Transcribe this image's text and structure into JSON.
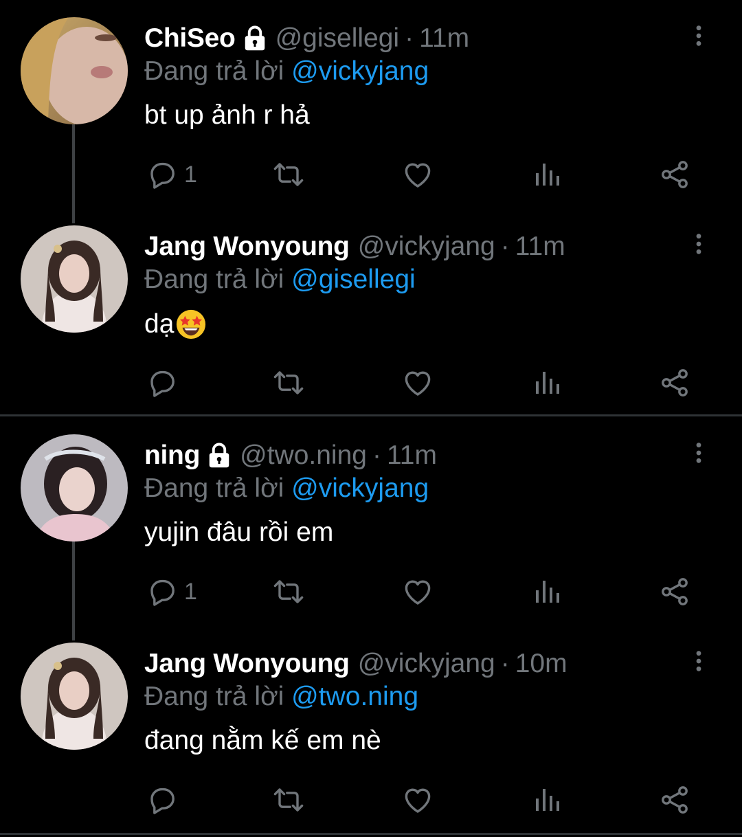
{
  "colors": {
    "background": "#000000",
    "name_text": "#ffffff",
    "muted_text": "#71767b",
    "mention_link": "#1d9bf0",
    "icon": "#71767b",
    "divider": "#2f3336"
  },
  "icons": {
    "lock": "lock-icon",
    "more": "more-vertical-icon",
    "reply": "reply-icon",
    "retweet": "retweet-icon",
    "like": "heart-icon",
    "views": "views-icon",
    "share": "share-icon"
  },
  "tweets": [
    {
      "name": "ChiSeo",
      "handle": "@gisellegi",
      "separator": "·",
      "time": "11m",
      "reply_prefix": "Đang trả lời",
      "reply_to": "@vickyjang",
      "text": "bt up ảnh r hả",
      "reply_count": "1"
    },
    {
      "name": "Jang Wonyoung",
      "handle": "@vickyjang",
      "separator": "·",
      "time": "11m",
      "reply_prefix": "Đang trả lời",
      "reply_to": "@gisellegi",
      "text": "dạ",
      "reply_count": ""
    },
    {
      "name": "ning",
      "handle": "@two.ning",
      "separator": "·",
      "time": "11m",
      "reply_prefix": "Đang trả lời",
      "reply_to": "@vickyjang",
      "text": "yujin đâu rồi em",
      "reply_count": "1"
    },
    {
      "name": "Jang Wonyoung",
      "handle": "@vickyjang",
      "separator": "·",
      "time": "10m",
      "reply_prefix": "Đang trả lời",
      "reply_to": "@two.ning",
      "text": "đang nằm kế em nè",
      "reply_count": ""
    }
  ]
}
